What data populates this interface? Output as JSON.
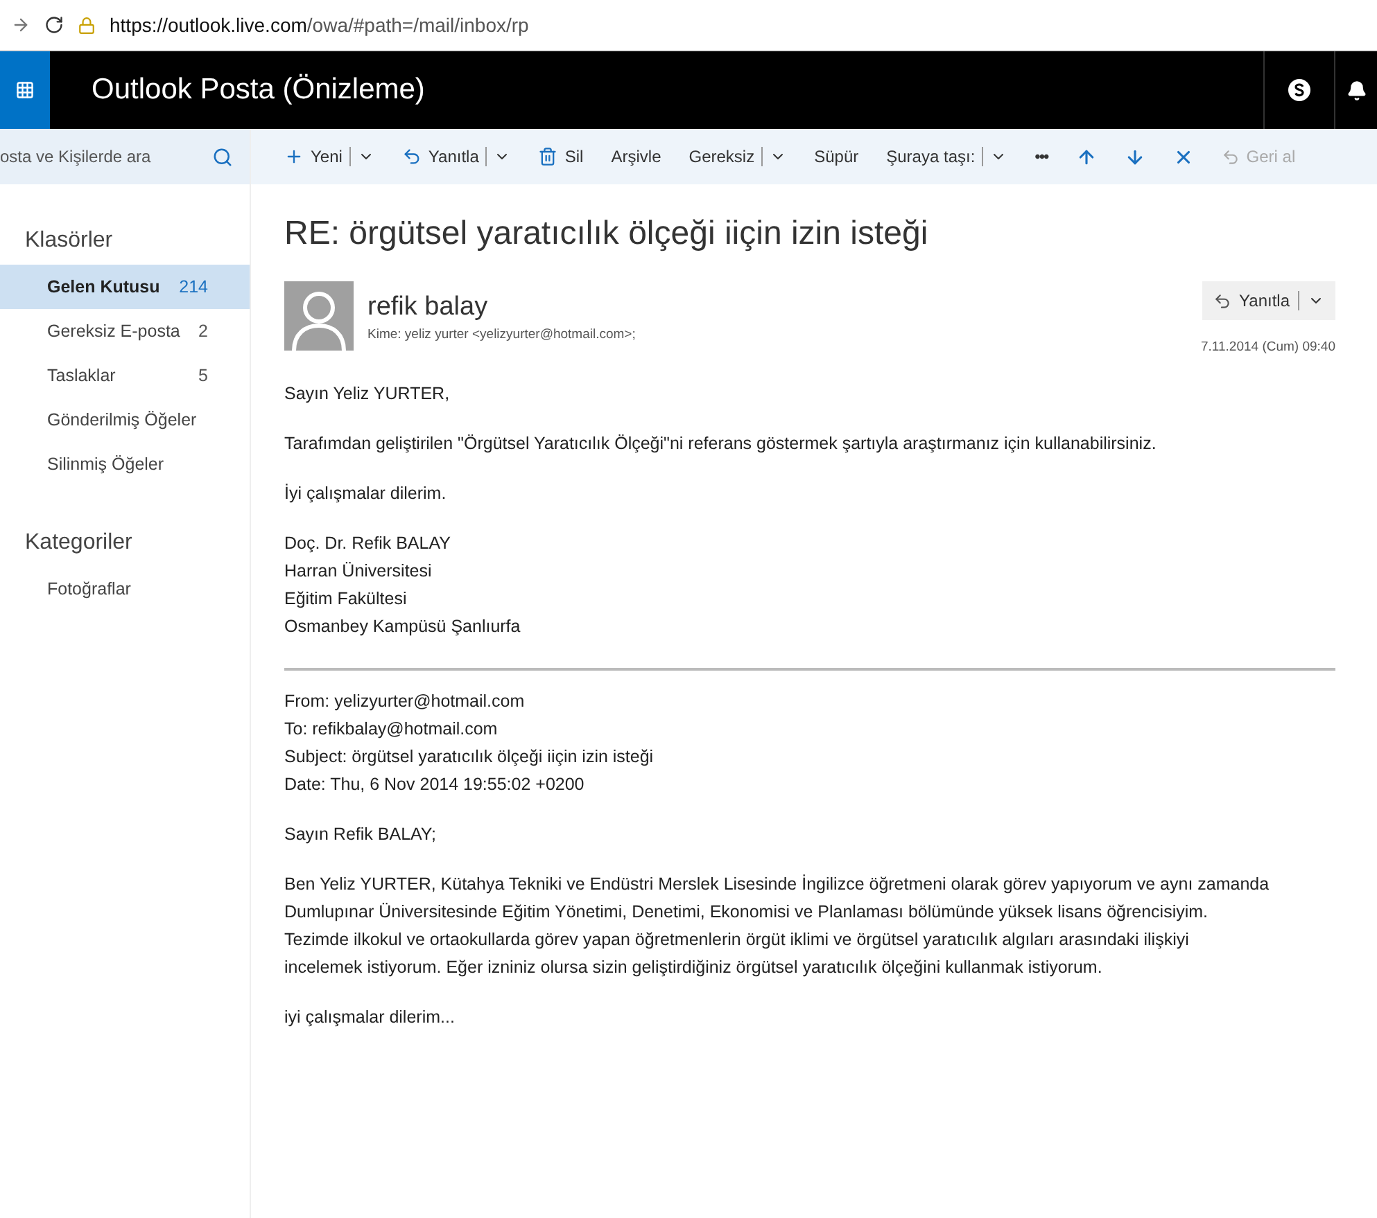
{
  "browser": {
    "url_host": "https://outlook.live.com",
    "url_path": "/owa/#path=/mail/inbox/rp"
  },
  "header": {
    "title": "Outlook Posta (Önizleme)"
  },
  "search": {
    "placeholder": "osta ve Kişilerde ara"
  },
  "toolbar": [
    {
      "kind": "plus",
      "label": "Yeni",
      "dropdown": true,
      "disabled": false
    },
    {
      "kind": "reply",
      "label": "Yanıtla",
      "dropdown": true,
      "disabled": false
    },
    {
      "kind": "trash",
      "label": "Sil",
      "dropdown": false,
      "disabled": false
    },
    {
      "kind": "text",
      "label": "Arşivle",
      "dropdown": false,
      "disabled": false
    },
    {
      "kind": "text",
      "label": "Gereksiz",
      "dropdown": true,
      "disabled": false
    },
    {
      "kind": "text",
      "label": "Süpür",
      "dropdown": false,
      "disabled": false
    },
    {
      "kind": "text",
      "label": "Şuraya taşı:",
      "dropdown": true,
      "disabled": false
    },
    {
      "kind": "more",
      "label": "•••",
      "dropdown": false,
      "disabled": false
    },
    {
      "kind": "up",
      "dropdown": false,
      "disabled": false
    },
    {
      "kind": "down",
      "dropdown": false,
      "disabled": false
    },
    {
      "kind": "close",
      "dropdown": false,
      "disabled": false
    },
    {
      "kind": "undo",
      "label": "Geri al",
      "dropdown": false,
      "disabled": true
    }
  ],
  "sidebar": [
    {
      "heading": "Klasörler",
      "items": [
        {
          "label": "Gelen Kutusu",
          "count": "214",
          "selected": true
        },
        {
          "label": "Gereksiz E-posta",
          "count": "2",
          "selected": false
        },
        {
          "label": "Taslaklar",
          "count": "5",
          "selected": false
        },
        {
          "label": "Gönderilmiş Öğeler",
          "selected": false
        },
        {
          "label": "Silinmiş Öğeler",
          "selected": false
        }
      ]
    },
    {
      "heading": "Kategoriler",
      "items": [
        {
          "label": "Fotoğraflar",
          "selected": false
        }
      ]
    }
  ],
  "message": {
    "subject": "RE: örgütsel yaratıcılık ölçeği iiçin izin isteği",
    "sender": "refik balay",
    "to": "Kime: yeliz yurter <yelizyurter@hotmail.com>;",
    "reply_label": "Yanıtla",
    "date": "7.11.2014 (Cum) 09:40",
    "body": [
      {
        "kind": "para",
        "lines": [
          "Sayın Yeliz YURTER,"
        ]
      },
      {
        "kind": "para",
        "lines": [
          "Tarafımdan geliştirilen \"Örgütsel Yaratıcılık Ölçeği\"ni referans göstermek şartıyla araştırmanız için kullanabilirsiniz."
        ]
      },
      {
        "kind": "para",
        "lines": [
          "İyi çalışmalar dilerim."
        ]
      },
      {
        "kind": "para",
        "lines": [
          "Doç. Dr. Refik BALAY",
          "Harran Üniversitesi",
          "Eğitim Fakültesi",
          "Osmanbey Kampüsü Şanlıurfa"
        ]
      },
      {
        "kind": "rule"
      },
      {
        "kind": "para",
        "lines": [
          "From: yelizyurter@hotmail.com",
          "To: refikbalay@hotmail.com",
          "Subject: örgütsel yaratıcılık ölçeği iiçin izin isteği",
          "Date: Thu, 6 Nov 2014 19:55:02 +0200"
        ]
      },
      {
        "kind": "para",
        "lines": [
          "Sayın Refik BALAY;"
        ]
      },
      {
        "kind": "para",
        "lines": [
          "Ben Yeliz YURTER, Kütahya Tekniki ve Endüstri Merslek Lisesinde İngilizce öğretmeni olarak görev yapıyorum ve aynı zamanda",
          "Dumlupınar Üniversitesinde Eğitim Yönetimi, Denetimi, Ekonomisi ve Planlaması bölümünde yüksek lisans öğrencisiyim.",
          "Tezimde ilkokul ve ortaokullarda görev yapan öğretmenlerin örgüt iklimi ve örgütsel yaratıcılık algıları arasındaki ilişkiyi",
          "incelemek istiyorum. Eğer izniniz olursa sizin geliştirdiğiniz örgütsel yaratıcılık ölçeğini kullanmak istiyorum."
        ]
      },
      {
        "kind": "para",
        "lines": [
          "iyi çalışmalar dilerim..."
        ]
      }
    ]
  }
}
